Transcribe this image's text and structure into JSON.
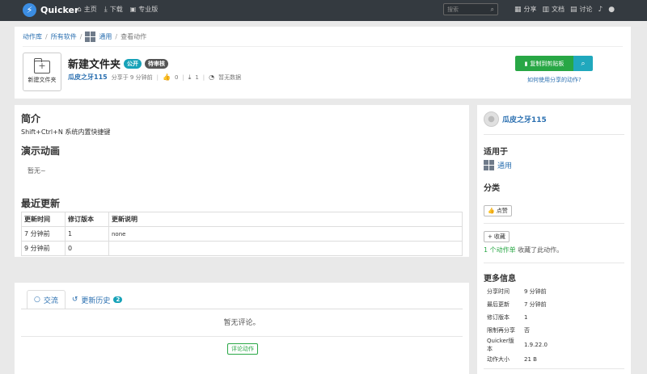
{
  "nav": {
    "brand": "Quicker",
    "left": [
      {
        "icon": "home-icon",
        "glyph": "⌂",
        "label": "主页"
      },
      {
        "icon": "download-icon",
        "glyph": "⤓",
        "label": "下载"
      },
      {
        "icon": "cart-icon",
        "glyph": "🛒",
        "label": "专业版"
      }
    ],
    "search_placeholder": "搜索",
    "right": [
      {
        "icon": "share-grid-icon",
        "glyph": "▦",
        "label": "分享"
      },
      {
        "icon": "docs-icon",
        "glyph": "▥",
        "label": "文档"
      },
      {
        "icon": "discuss-icon",
        "glyph": "💬",
        "label": "讨论"
      },
      {
        "icon": "bell-icon",
        "glyph": "🔔",
        "label": ""
      },
      {
        "icon": "user-icon",
        "glyph": "●",
        "label": ""
      }
    ]
  },
  "breadcrumb": {
    "items": [
      "动作库",
      "所有软件",
      "通用",
      "查看动作"
    ]
  },
  "action": {
    "icon_label": "新建文件夹",
    "title": "新建文件夹",
    "badge_public": "公开",
    "badge_review": "待审核",
    "author": "瓜皮之牙115",
    "shared": "分享于 9 分钟前",
    "likes": "0",
    "downloads": "1",
    "store": "暂无数据",
    "copy_label": "复制到剪贴板",
    "howto_link": "如何使用分享的动作?"
  },
  "intro": {
    "heading": "简介",
    "text": "Shift+Ctrl+N 系统内置快捷键"
  },
  "demo": {
    "heading": "演示动画",
    "empty": "暂无~"
  },
  "updates": {
    "heading": "最近更新",
    "columns": [
      "更新时间",
      "修订版本",
      "更新说明"
    ],
    "rows": [
      {
        "time": "7 分钟前",
        "rev": "1",
        "desc": "none"
      },
      {
        "time": "9 分钟前",
        "rev": "0",
        "desc": ""
      }
    ]
  },
  "comments": {
    "tab_discuss": "交流",
    "tab_history": "更新历史",
    "history_count": "2",
    "empty": "暂无评论。",
    "comment_button": "评论动作"
  },
  "sidebar": {
    "author": "瓜皮之牙115",
    "applies_heading": "适用于",
    "applies_value": "通用",
    "category_heading": "分类",
    "like_button": "点赞",
    "collect_button": "收藏",
    "collect_count": "1 个动作单",
    "collect_text": " 收藏了此动作。",
    "more_heading": "更多信息",
    "info": [
      {
        "k": "分享时间",
        "v": "9 分钟前"
      },
      {
        "k": "最后更新",
        "v": "7 分钟前"
      },
      {
        "k": "修订版本",
        "v": "1"
      },
      {
        "k": "限制再分享",
        "v": "否"
      },
      {
        "k": "Quicker版本",
        "v": "1.9.22.0"
      },
      {
        "k": "动作大小",
        "v": "21 B"
      }
    ]
  },
  "colors": {
    "navbar": "#343a40",
    "primary_link": "#2a6fb0",
    "success": "#28a745",
    "info": "#17a2b8"
  }
}
